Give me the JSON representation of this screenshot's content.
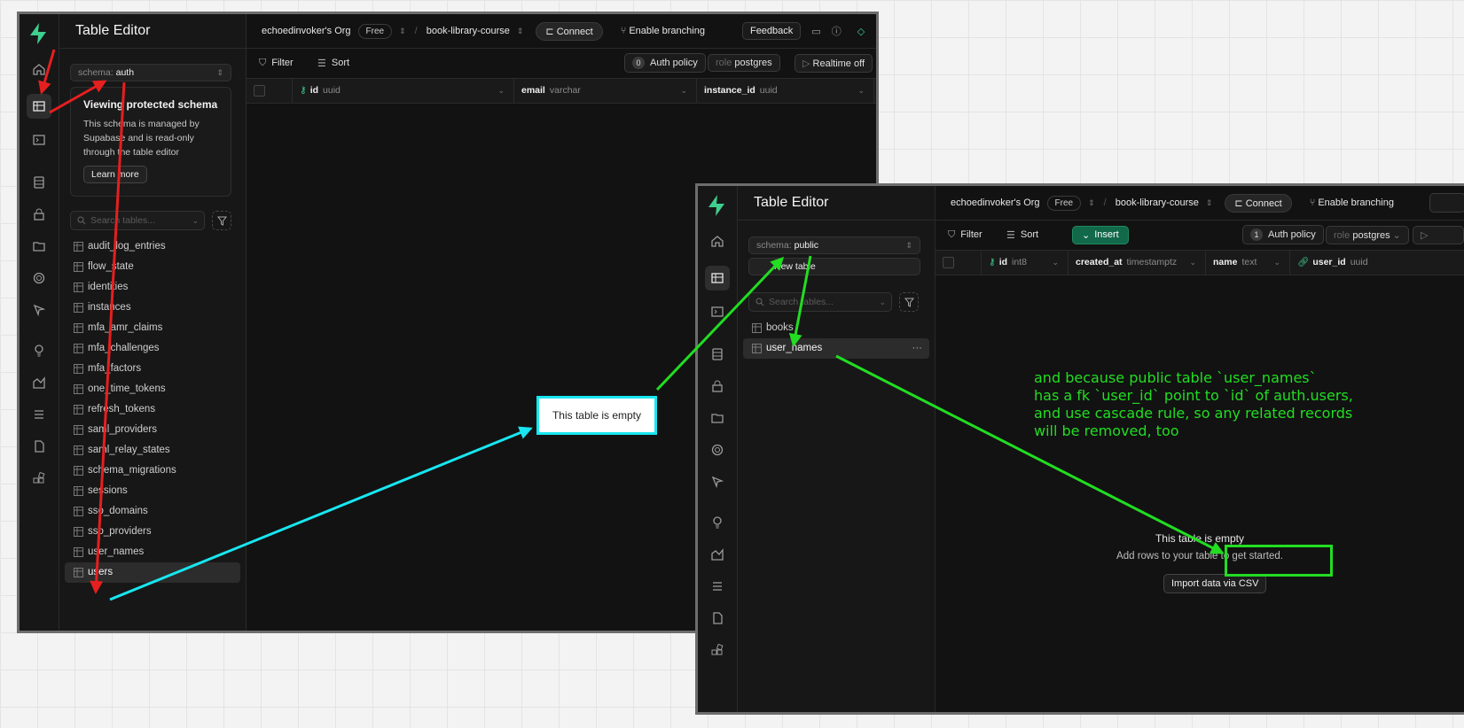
{
  "left_window": {
    "app_title": "Table Editor",
    "org": "echoedinvoker's Org",
    "plan": "Free",
    "project": "book-library-course",
    "connect": "Connect",
    "branching": "Enable branching",
    "feedback": "Feedback",
    "schema_label": "schema:",
    "schema_value": "auth",
    "notice": {
      "title": "Viewing protected schema",
      "body": "This schema is managed by Supabase and is read-only through the table editor",
      "button": "Learn more"
    },
    "search_placeholder": "Search tables...",
    "tables": [
      "audit_log_entries",
      "flow_state",
      "identities",
      "instances",
      "mfa_amr_claims",
      "mfa_challenges",
      "mfa_factors",
      "one_time_tokens",
      "refresh_tokens",
      "saml_providers",
      "saml_relay_states",
      "schema_migrations",
      "sessions",
      "sso_domains",
      "sso_providers",
      "user_names",
      "users"
    ],
    "selected_table": "users",
    "toolbar": {
      "filter": "Filter",
      "sort": "Sort",
      "auth_count": "0",
      "auth_policy": "Auth policy",
      "role_label": "role",
      "role_value": "postgres",
      "realtime": "Realtime off"
    },
    "columns": [
      {
        "name": "id",
        "type": "uuid"
      },
      {
        "name": "email",
        "type": "varchar"
      },
      {
        "name": "instance_id",
        "type": "uuid"
      }
    ]
  },
  "right_window": {
    "app_title": "Table Editor",
    "org": "echoedinvoker's Org",
    "plan": "Free",
    "project": "book-library-course",
    "connect": "Connect",
    "branching": "Enable branching",
    "schema_label": "schema:",
    "schema_value": "public",
    "new_table": "New table",
    "search_placeholder": "Search tables...",
    "tables": [
      "books",
      "user_names"
    ],
    "selected_table": "user_names",
    "toolbar": {
      "filter": "Filter",
      "sort": "Sort",
      "insert": "Insert",
      "auth_count": "1",
      "auth_policy": "Auth policy",
      "role_label": "role",
      "role_value": "postgres"
    },
    "columns": [
      {
        "name": "id",
        "type": "int8"
      },
      {
        "name": "created_at",
        "type": "timestamptz"
      },
      {
        "name": "name",
        "type": "text"
      },
      {
        "name": "user_id",
        "type": "uuid"
      }
    ],
    "empty_title": "This table is empty",
    "empty_sub": "Add rows to your table to get started.",
    "import_btn": "Import data via CSV"
  },
  "callout_text": "This table is empty",
  "annotation": "and because public table `user_names`\nhas a fk `user_id` point to `id` of auth.users,\nand use cascade rule, so any related records\nwill be removed, too",
  "colors": {
    "arrow_red": "#e61f1f",
    "arrow_cyan": "#18e6f0",
    "arrow_green": "#22dd22",
    "brand": "#3ecf8e"
  }
}
